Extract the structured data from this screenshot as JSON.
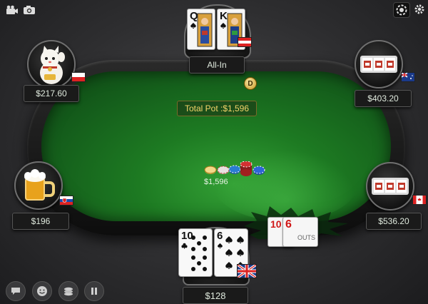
{
  "pot": {
    "label": "Total Pot :$1,596",
    "chips_amount": "$1,596"
  },
  "dealer_button": "D",
  "seats": {
    "top": {
      "status": "All-In",
      "cards": [
        "Q",
        "K"
      ],
      "name": ""
    },
    "top_left": {
      "stack": "$217.60",
      "name": ""
    },
    "top_right": {
      "stack": "$403.20",
      "name": ""
    },
    "left": {
      "stack": "$196",
      "name": ""
    },
    "right": {
      "stack": "$536.20",
      "name": ""
    },
    "hero": {
      "stack": "$128",
      "cards": [
        "10",
        "6"
      ],
      "name": ""
    }
  },
  "outs": {
    "cards": [
      "10",
      "6"
    ],
    "label": "OUTS"
  },
  "toolbar": {
    "left_icons": [
      "camera-film-icon",
      "camera-icon"
    ],
    "right_icons": [
      "chip-settings-icon",
      "gear-icon"
    ]
  },
  "controls": [
    "chat-icon",
    "emoji-icon",
    "chip-stack-icon",
    "pause-icon"
  ],
  "colors": {
    "felt": "#1d7a22",
    "pot_text": "#f3d46a",
    "stack_text": "#dfe9dd"
  }
}
